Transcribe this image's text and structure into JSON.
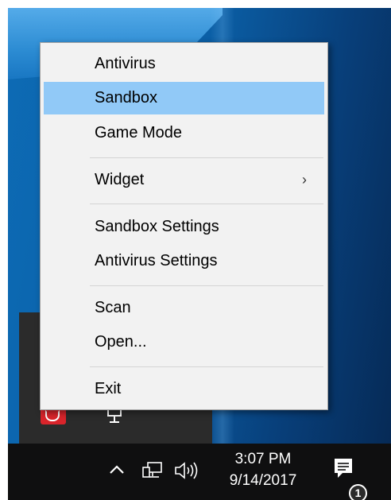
{
  "context_menu": {
    "items": [
      {
        "label": "Antivirus"
      },
      {
        "label": "Sandbox",
        "highlighted": true
      },
      {
        "label": "Game Mode"
      },
      {
        "label": "Widget",
        "submenu_icon": "chevron-right-icon",
        "submenu_glyph": "›"
      },
      {
        "label": "Sandbox Settings"
      },
      {
        "label": "Antivirus Settings"
      },
      {
        "label": "Scan"
      },
      {
        "label": "Open..."
      },
      {
        "label": "Exit"
      }
    ],
    "highlight_color": "#91c9f7"
  },
  "tray_flyout": {
    "icons": [
      "antivirus-tray-icon",
      "widget-tray-icon"
    ]
  },
  "taskbar": {
    "show_hidden_icons_glyph": "^",
    "network_icon": "network-icon",
    "volume_icon": "volume-icon",
    "clock": {
      "time": "3:07 PM",
      "date": "9/14/2017"
    },
    "action_center": {
      "icon": "action-center-icon",
      "badge_count": "1"
    }
  }
}
